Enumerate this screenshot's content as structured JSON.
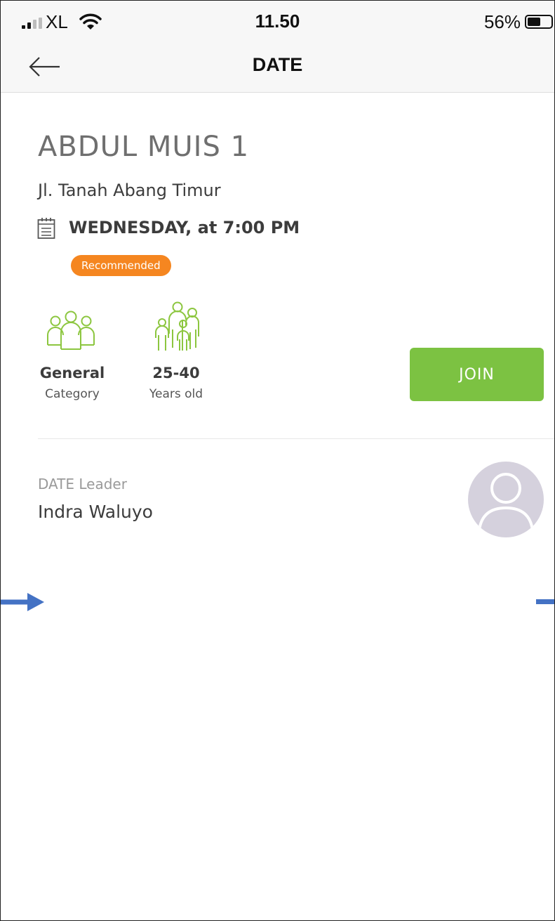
{
  "status_bar": {
    "carrier": "XL",
    "time": "11.50",
    "battery_percent": "56%",
    "battery_level": 0.56
  },
  "nav": {
    "title": "DATE"
  },
  "venue": {
    "name": "ABDUL MUIS 1",
    "address": "Jl. Tanah Abang Timur",
    "schedule": "WEDNESDAY, at 7:00 PM",
    "badge": "Recommended"
  },
  "stats": {
    "category": {
      "value": "General",
      "label": "Category"
    },
    "age": {
      "value": "25-40",
      "label": "Years old"
    }
  },
  "join_label": "JOIN",
  "leader": {
    "label": "DATE Leader",
    "name": "Indra Waluyo"
  },
  "colors": {
    "accent_green": "#7cc242",
    "badge_orange": "#f58620",
    "icon_green": "#8cc63f",
    "marker_blue": "#4472c4",
    "avatar_bg": "#d5d1dd"
  },
  "icons": {
    "back": "arrow-left-icon",
    "calendar": "calendar-icon",
    "category": "group-icon",
    "age": "family-icon",
    "avatar": "user-silhouette-icon"
  }
}
